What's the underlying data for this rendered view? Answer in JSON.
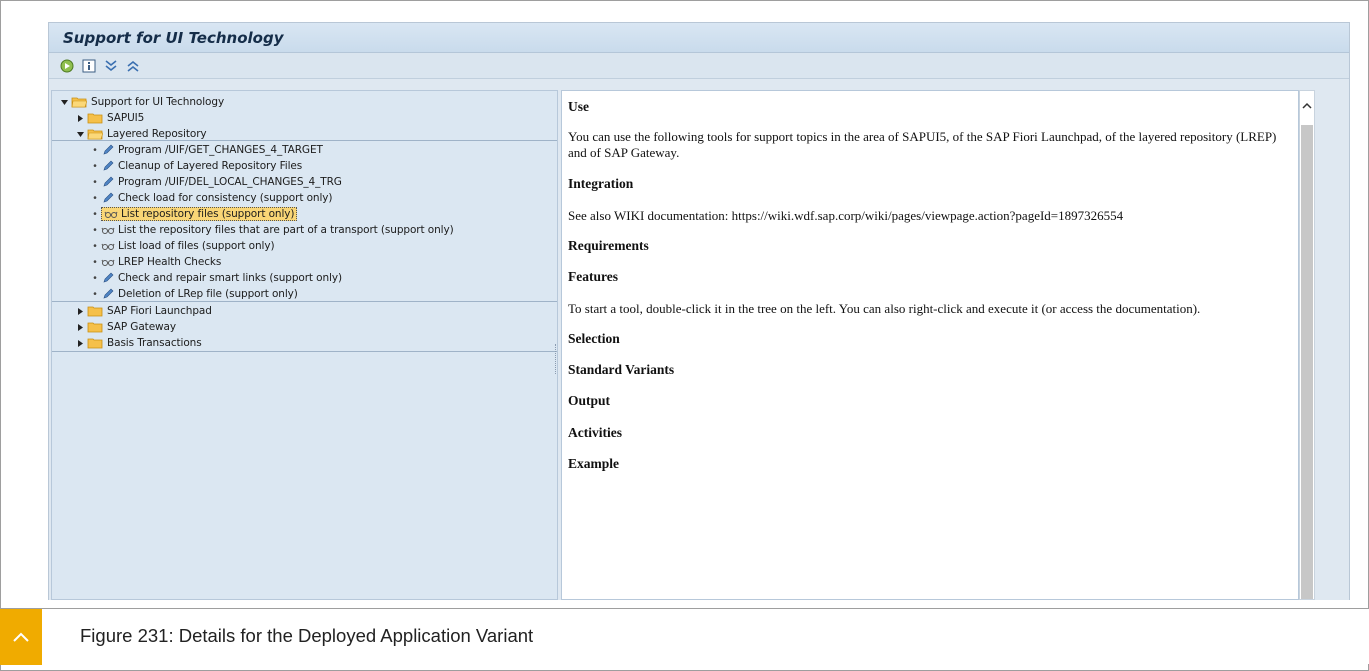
{
  "window": {
    "title": "Support for UI Technology"
  },
  "toolbar": {
    "buttons": [
      {
        "icon": "execute-icon"
      },
      {
        "icon": "info-icon"
      },
      {
        "icon": "expand-all-icon"
      },
      {
        "icon": "collapse-all-icon"
      }
    ]
  },
  "tree": {
    "root": "Support for UI Technology",
    "sapui5": "SAPUI5",
    "layered_repository": "Layered Repository",
    "items": [
      "Program /UIF/GET_CHANGES_4_TARGET",
      "Cleanup of Layered Repository Files",
      "Program /UIF/DEL_LOCAL_CHANGES_4_TRG",
      "Check load for consistency (support only)",
      "List repository files (support only)",
      "List the repository files that are part of a transport (support only)",
      "List load of files (support only)",
      "LREP Health Checks",
      "Check and repair smart links (support only)",
      "Deletion of LRep file (support only)"
    ],
    "sap_fiori_launchpad": "SAP Fiori Launchpad",
    "sap_gateway": "SAP Gateway",
    "basis_transactions": "Basis Transactions",
    "selected_item": "List repository files (support only)"
  },
  "doc": {
    "use_heading": "Use",
    "use_text": "You can use the following tools for support topics in the area of SAPUI5, of the SAP Fiori Launchpad, of the layered repository (LREP) and of SAP Gateway.",
    "integration_heading": "Integration",
    "integration_text": "See also WIKI documentation: https://wiki.wdf.sap.corp/wiki/pages/viewpage.action?pageId=1897326554",
    "requirements_heading": "Requirements",
    "features_heading": "Features",
    "features_text": "To start a tool, double-click it in the tree on the left. You can also right-click and execute it (or access the documentation).",
    "selection_heading": "Selection",
    "standard_variants_heading": "Standard Variants",
    "output_heading": "Output",
    "activities_heading": "Activities",
    "example_heading": "Example"
  },
  "caption": {
    "text": "Figure 231: Details for the Deployed Application Variant"
  },
  "colors": {
    "accent": "#f0ab00",
    "selection": "#f9d676",
    "tree_bg": "#dbe7f2",
    "folder": "#f5c04a"
  }
}
